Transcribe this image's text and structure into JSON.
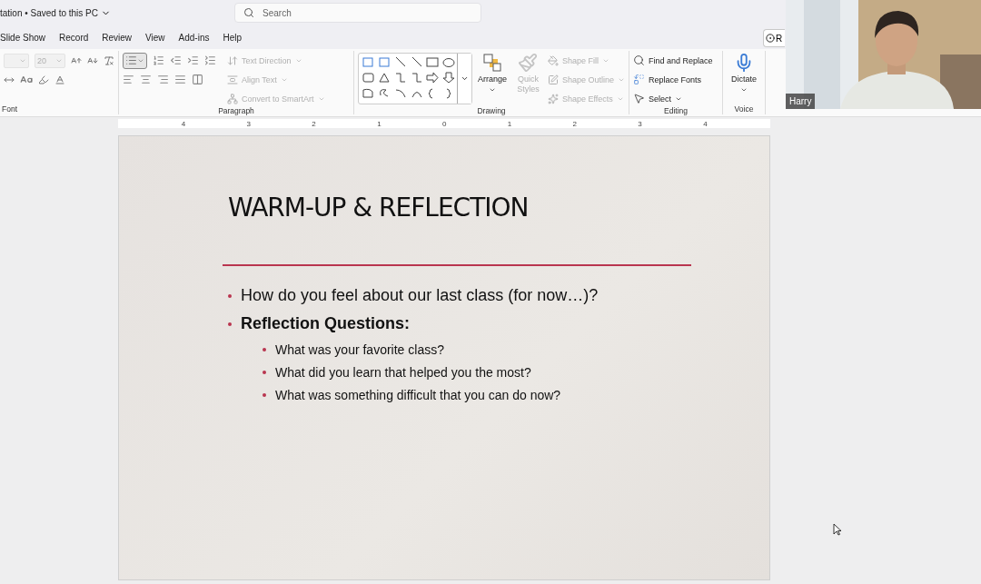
{
  "document": {
    "title": "tation • Saved to this PC"
  },
  "search": {
    "placeholder": "Search"
  },
  "tabs": [
    {
      "label": "Slide Show"
    },
    {
      "label": "Record"
    },
    {
      "label": "Review"
    },
    {
      "label": "View"
    },
    {
      "label": "Add-ins"
    },
    {
      "label": "Help"
    }
  ],
  "record_button": {
    "label": "R"
  },
  "font_group": {
    "label": "Font",
    "font_size": "20"
  },
  "paragraph_group": {
    "label": "Paragraph",
    "bullets_selected": true,
    "commands": [
      {
        "label": "Text Direction",
        "disabled": true
      },
      {
        "label": "Align Text",
        "disabled": true
      },
      {
        "label": "Convert to SmartArt",
        "disabled": true
      }
    ]
  },
  "drawing_group": {
    "label": "Drawing",
    "arrange": {
      "label": "Arrange",
      "disabled": false
    },
    "quick_styles": {
      "label": "Quick Styles",
      "disabled": true
    },
    "commands": [
      {
        "label": "Shape Fill",
        "disabled": true
      },
      {
        "label": "Shape Outline",
        "disabled": true
      },
      {
        "label": "Shape Effects",
        "disabled": true
      }
    ]
  },
  "editing_group": {
    "label": "Editing",
    "commands": [
      {
        "label": "Find and Replace",
        "kind": "find"
      },
      {
        "label": "Replace Fonts",
        "kind": "fonts"
      },
      {
        "label": "Select",
        "kind": "select"
      }
    ]
  },
  "voice_group": {
    "label": "Voice",
    "dictate": "Dictate"
  },
  "ruler": {
    "ticks": [
      "4",
      "3",
      "2",
      "1",
      "0",
      "1",
      "2",
      "3",
      "4"
    ]
  },
  "slide": {
    "title": "WARM-UP & REFLECTION",
    "bullets": [
      {
        "text": "How do you feel about our last class (for now…)?",
        "bold": false
      },
      {
        "text": "Reflection Questions:",
        "bold": true,
        "children": [
          {
            "text": "What was your favorite class?"
          },
          {
            "text": "What did you learn that helped you the most?"
          },
          {
            "text": "What was something difficult that you can do now?"
          }
        ]
      }
    ]
  },
  "video": {
    "name": "Harry"
  }
}
